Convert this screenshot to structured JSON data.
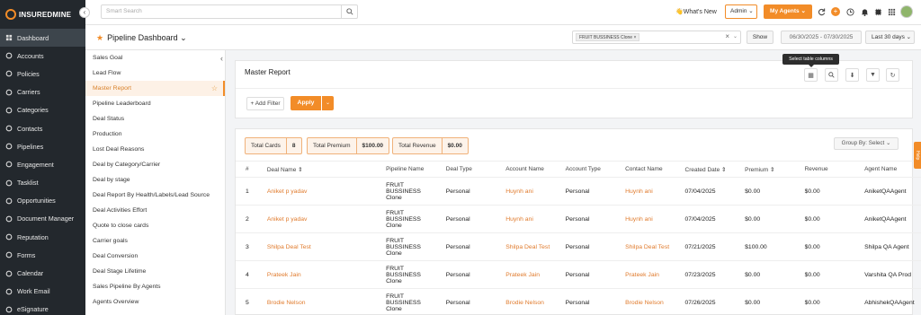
{
  "brand": {
    "name": "INSUREDMINE",
    "accent": "#f28c28",
    "nav_bg": "#23282d"
  },
  "nav": {
    "items": [
      {
        "label": "Dashboard",
        "icon": "dashboard-icon",
        "active": true
      },
      {
        "label": "Accounts",
        "icon": "user-icon"
      },
      {
        "label": "Policies",
        "icon": "document-icon"
      },
      {
        "label": "Carriers",
        "icon": "building-icon"
      },
      {
        "label": "Categories",
        "icon": "tag-icon"
      },
      {
        "label": "Contacts",
        "icon": "contact-icon"
      },
      {
        "label": "Pipelines",
        "icon": "filter-icon"
      },
      {
        "label": "Engagement",
        "icon": "megaphone-icon"
      },
      {
        "label": "Tasklist",
        "icon": "list-icon"
      },
      {
        "label": "Opportunities",
        "icon": "target-icon"
      },
      {
        "label": "Document Manager",
        "icon": "folder-icon"
      },
      {
        "label": "Reputation",
        "icon": "star-icon"
      },
      {
        "label": "Forms",
        "icon": "form-icon"
      },
      {
        "label": "Calendar",
        "icon": "calendar-icon"
      },
      {
        "label": "Work Email",
        "icon": "mail-icon"
      },
      {
        "label": "eSignature",
        "icon": "signature-icon"
      }
    ]
  },
  "topbar": {
    "search_placeholder": "Smart Search",
    "whats_new": "What's New",
    "role": "Admin",
    "my_agents": "My Agents"
  },
  "header": {
    "title": "Pipeline Dashboard",
    "filter_chip": "FRUIT BUSSINESS Clone",
    "show_label": "Show",
    "date_range": "06/30/2025 - 07/30/2025",
    "period": "Last 30 days"
  },
  "reports": [
    "Sales Goal",
    "Lead Flow",
    "Master Report",
    "Pipeline Leaderboard",
    "Deal Status",
    "Production",
    "Lost Deal Reasons",
    "Deal by Category/Carrier",
    "Deal by stage",
    "Deal Report By Health/Labels/Lead Source",
    "Deal Activities Effort",
    "Quote to close cards",
    "Carrier goals",
    "Deal Conversion",
    "Deal Stage Lifetime",
    "Sales Pipeline By Agents",
    "Agents Overview"
  ],
  "active_report_index": 2,
  "main": {
    "title": "Master Report",
    "tooltip": "Select table columns",
    "add_filter": "+ Add Filter",
    "apply": "Apply",
    "group_by": "Group By: Select",
    "help_tab": "Help"
  },
  "stats": [
    {
      "label": "Total Cards",
      "value": "8"
    },
    {
      "label": "Total Premium",
      "value": "$100.00"
    },
    {
      "label": "Total Revenue",
      "value": "$0.00"
    }
  ],
  "table": {
    "columns": [
      "#",
      "Deal Name ⇕",
      "Pipeline Name",
      "Deal Type",
      "Account Name",
      "Account Type",
      "Contact Name",
      "Created Date ⇕",
      "Premium ⇕",
      "Revenue",
      "Agent Name"
    ],
    "rows": [
      [
        "1",
        "Aniket p yadav",
        "FRUIT BUSSINESS Clone",
        "Personal",
        "Huynh ani",
        "Personal",
        "Huynh ani",
        "07/04/2025",
        "$0.00",
        "$0.00",
        "AniketQAAgent"
      ],
      [
        "2",
        "Aniket p yadav",
        "FRUIT BUSSINESS Clone",
        "Personal",
        "Huynh ani",
        "Personal",
        "Huynh ani",
        "07/04/2025",
        "$0.00",
        "$0.00",
        "AniketQAAgent"
      ],
      [
        "3",
        "Shilpa Deal Test",
        "FRUIT BUSSINESS Clone",
        "Personal",
        "Shilpa Deal Test",
        "Personal",
        "Shilpa Deal Test",
        "07/21/2025",
        "$100.00",
        "$0.00",
        "Shilpa QA Agent"
      ],
      [
        "4",
        "Prateek Jain",
        "FRUIT BUSSINESS Clone",
        "Personal",
        "Prateek Jain",
        "Personal",
        "Prateek Jain",
        "07/23/2025",
        "$0.00",
        "$0.00",
        "Varshita QA Prod"
      ],
      [
        "5",
        "Brodie Nelson",
        "FRUIT BUSSINESS Clone",
        "Personal",
        "Brodie Nelson",
        "Personal",
        "Brodie Nelson",
        "07/26/2025",
        "$0.00",
        "$0.00",
        "AbhishekQAAgent"
      ]
    ]
  }
}
